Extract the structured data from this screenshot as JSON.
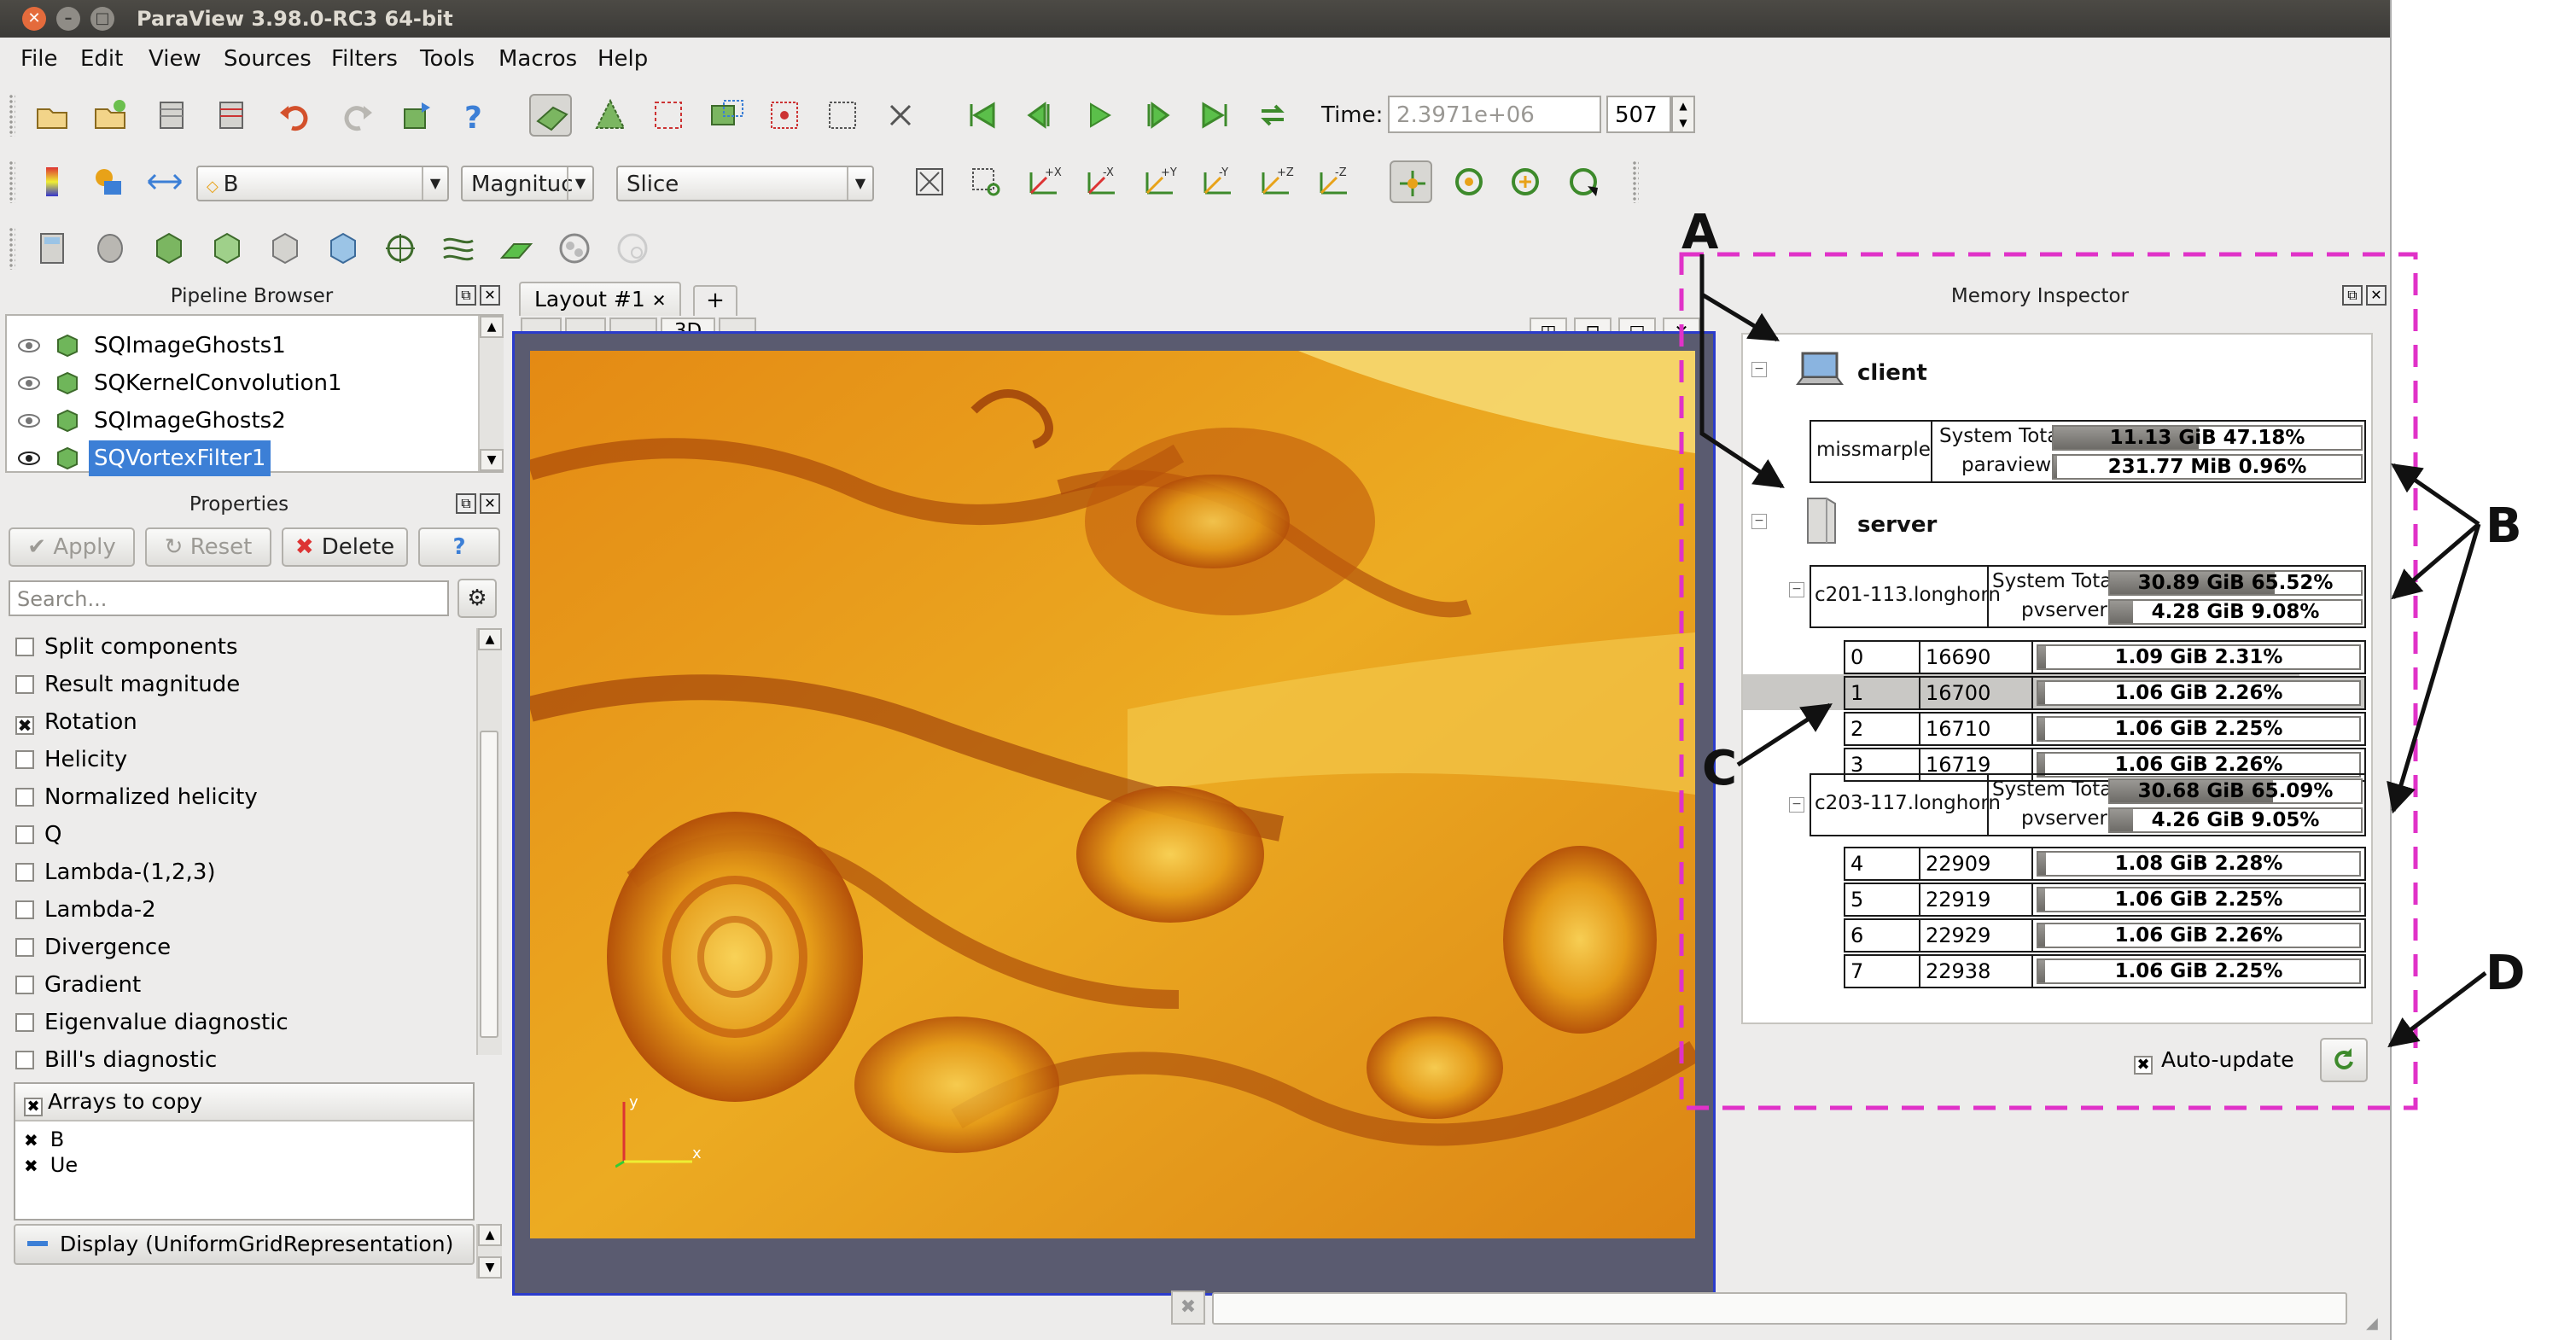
{
  "window": {
    "title": "ParaView 3.98.0-RC3 64-bit"
  },
  "menu": [
    "File",
    "Edit",
    "View",
    "Sources",
    "Filters",
    "Tools",
    "Macros",
    "Help"
  ],
  "toolbar": {
    "time_label": "Time:",
    "time_value": "2.3971e+06",
    "timestep": "507",
    "array_combo": "B",
    "component_combo": "Magnituc",
    "representation_combo": "Slice"
  },
  "pipeline": {
    "title": "Pipeline Browser",
    "items": [
      {
        "label": "SQImageGhosts1",
        "selected": false
      },
      {
        "label": "SQKernelConvolution1",
        "selected": false
      },
      {
        "label": "SQImageGhosts2",
        "selected": false
      },
      {
        "label": "SQVortexFilter1",
        "selected": true
      }
    ]
  },
  "properties": {
    "title": "Properties",
    "apply": "Apply",
    "reset": "Reset",
    "delete": "Delete",
    "help": "?",
    "search_placeholder": "Search...",
    "options": [
      {
        "label": "Split components",
        "checked": false
      },
      {
        "label": "Result magnitude",
        "checked": false
      },
      {
        "label": "Rotation",
        "checked": true
      },
      {
        "label": "Helicity",
        "checked": false
      },
      {
        "label": "Normalized helicity",
        "checked": false
      },
      {
        "label": "Q",
        "checked": false
      },
      {
        "label": "Lambda-(1,2,3)",
        "checked": false
      },
      {
        "label": "Lambda-2",
        "checked": false
      },
      {
        "label": "Divergence",
        "checked": false
      },
      {
        "label": "Gradient",
        "checked": false
      },
      {
        "label": "Eigenvalue diagnostic",
        "checked": false
      },
      {
        "label": "Bill's diagnostic",
        "checked": false
      }
    ],
    "arrays_header": "Arrays to copy",
    "arrays": [
      {
        "label": "B",
        "checked": true
      },
      {
        "label": "Ue",
        "checked": true
      }
    ],
    "display": "Display (UniformGridRepresentation)"
  },
  "layout": {
    "tab": "Layout #1",
    "close": "✕",
    "add": "+",
    "view3d": "3D"
  },
  "axes": {
    "x": "x",
    "y": "y"
  },
  "memory": {
    "title": "Memory Inspector",
    "client_label": "client",
    "server_label": "server",
    "system_total_label": "System Total",
    "client_host": "missmarple",
    "client_proc": "paraview",
    "client_total": {
      "text": "11.13 GiB 47.18%",
      "fraction": 0.4718
    },
    "client_paraview": {
      "text": "231.77 MiB 0.96%",
      "fraction": 0.0096
    },
    "hosts": [
      {
        "name": "c201-113.longhorn",
        "total": {
          "text": "30.89 GiB 65.52%",
          "fraction": 0.6552
        },
        "proc_label": "pvserver",
        "proc": {
          "text": "4.28 GiB 9.08%",
          "fraction": 0.0908
        },
        "ranks": [
          {
            "rank": "0",
            "pid": "16690",
            "text": "1.09 GiB 2.31%",
            "fraction": 0.0231,
            "selected": false
          },
          {
            "rank": "1",
            "pid": "16700",
            "text": "1.06 GiB 2.26%",
            "fraction": 0.0226,
            "selected": true
          },
          {
            "rank": "2",
            "pid": "16710",
            "text": "1.06 GiB 2.25%",
            "fraction": 0.0225,
            "selected": false
          },
          {
            "rank": "3",
            "pid": "16719",
            "text": "1.06 GiB 2.26%",
            "fraction": 0.0226,
            "selected": false
          }
        ]
      },
      {
        "name": "c203-117.longhorn",
        "total": {
          "text": "30.68 GiB 65.09%",
          "fraction": 0.6509
        },
        "proc_label": "pvserver",
        "proc": {
          "text": "4.26 GiB 9.05%",
          "fraction": 0.0905
        },
        "ranks": [
          {
            "rank": "4",
            "pid": "22909",
            "text": "1.08 GiB 2.28%",
            "fraction": 0.0228,
            "selected": false
          },
          {
            "rank": "5",
            "pid": "22919",
            "text": "1.06 GiB 2.25%",
            "fraction": 0.0225,
            "selected": false
          },
          {
            "rank": "6",
            "pid": "22929",
            "text": "1.06 GiB 2.26%",
            "fraction": 0.0226,
            "selected": false
          },
          {
            "rank": "7",
            "pid": "22938",
            "text": "1.06 GiB 2.25%",
            "fraction": 0.0225,
            "selected": false
          }
        ]
      }
    ],
    "auto_update_label": "Auto-update",
    "auto_update": true
  },
  "annotations": {
    "a": "A",
    "b": "B",
    "c": "C",
    "d": "D"
  },
  "colors": {
    "accent_dash": "#e032c8",
    "selection": "#3c7fd6",
    "view_border": "#2b3ccc"
  }
}
